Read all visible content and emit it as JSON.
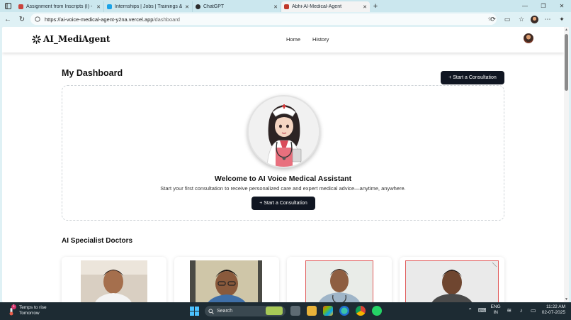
{
  "browser": {
    "tabs": [
      {
        "title": "Assignment from Inscripts (I) - m",
        "favicon_color": "#c9433d",
        "active": false
      },
      {
        "title": "Internships | Jobs | Trainings & Pl",
        "favicon_color": "#1aa3e8",
        "active": false
      },
      {
        "title": "ChatGPT",
        "favicon_color": "#2b2b2b",
        "active": false
      },
      {
        "title": "Abhi-AI-Medical-Agent",
        "favicon_color": "#c0392b",
        "active": true
      }
    ],
    "url_host": "https://ai-voice-medical-agent-y2na.vercel.app",
    "url_path": "/dashboard"
  },
  "app": {
    "logo_text": "AI_MediAgent",
    "nav": {
      "home": "Home",
      "history": "History"
    }
  },
  "dashboard": {
    "title": "My Dashboard",
    "start_cta": "+ Start a Consultation",
    "welcome_title": "Welcome to AI Voice Medical Assistant",
    "welcome_subtitle": "Start your first consultation to receive personalized care and expert medical advice—anytime, anywhere.",
    "welcome_cta": "+ Start a Consultation",
    "specialists_heading": "AI Specialist Doctors"
  },
  "taskbar": {
    "weather_title": "Temps to rise",
    "weather_sub": "Tomorrow",
    "weather_badge": "1",
    "search_placeholder": "Search",
    "lang_top": "ENG",
    "lang_bottom": "IN",
    "time": "11:22 AM",
    "date": "02-07-2025"
  },
  "colors": {
    "accent_dark": "#101622",
    "browser_bg": "#dff1f5",
    "taskbar_bg": "#1d2b33",
    "card_border_red": "#e15b5b"
  }
}
